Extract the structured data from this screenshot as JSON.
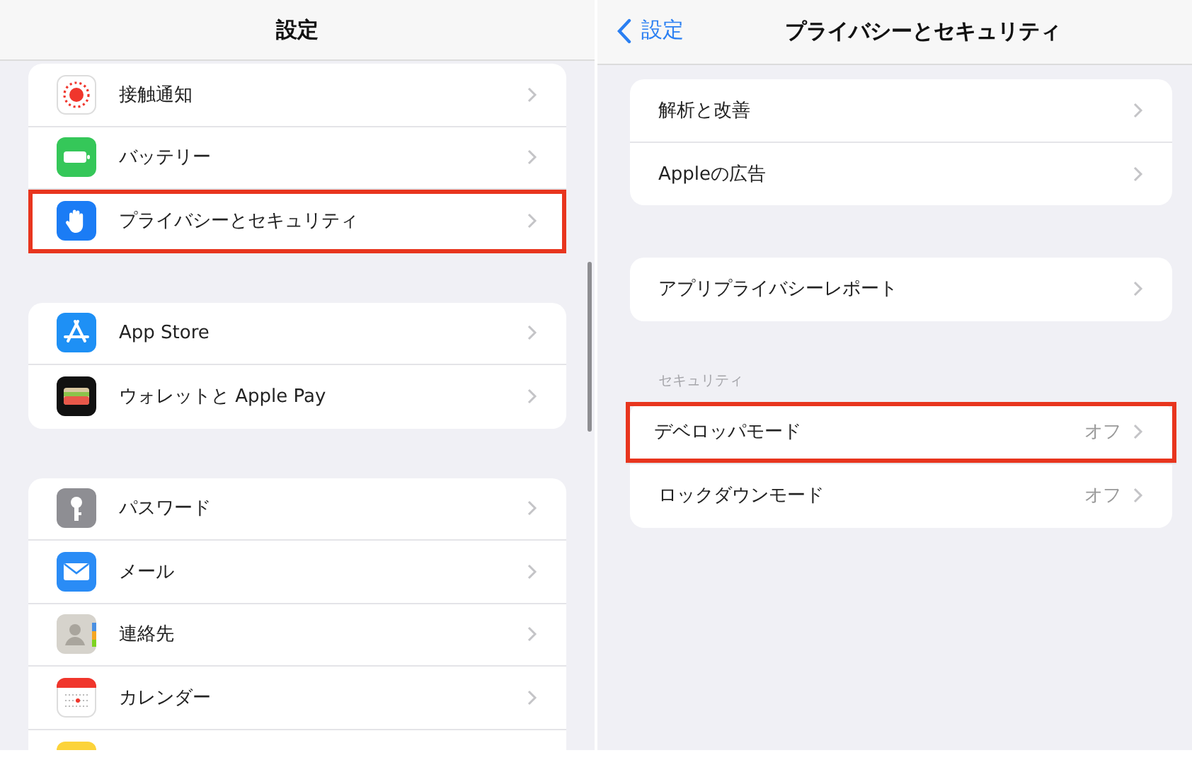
{
  "settings_panel": {
    "title": "設定",
    "groups": [
      {
        "items": [
          {
            "kind": "exposure",
            "label": "接触通知",
            "highlighted": false
          },
          {
            "kind": "battery",
            "label": "バッテリー",
            "highlighted": false
          },
          {
            "kind": "privacy",
            "label": "プライバシーとセキュリティ",
            "highlighted": true
          }
        ]
      },
      {
        "items": [
          {
            "kind": "appstore",
            "label": "App Store",
            "highlighted": false
          },
          {
            "kind": "wallet",
            "label": "ウォレットと Apple Pay",
            "highlighted": false
          }
        ]
      },
      {
        "items": [
          {
            "kind": "passwords",
            "label": "パスワード",
            "highlighted": false
          },
          {
            "kind": "mail",
            "label": "メール",
            "highlighted": false
          },
          {
            "kind": "contacts",
            "label": "連絡先",
            "highlighted": false
          },
          {
            "kind": "calendar",
            "label": "カレンダー",
            "highlighted": false
          },
          {
            "kind": "notes",
            "highlighted": false
          }
        ]
      }
    ]
  },
  "privacy_panel": {
    "back": "設定",
    "title": "プライバシーとセキュリティ",
    "groups": [
      {
        "items": [
          {
            "label": "解析と改善",
            "highlighted": false
          },
          {
            "label": "Appleの広告",
            "highlighted": false
          }
        ]
      },
      {
        "items": [
          {
            "label": "アプリプライバシーレポート",
            "highlighted": false
          }
        ]
      },
      {
        "header": "セキュリティ",
        "items": [
          {
            "label": "デベロッパモード",
            "value": "オフ",
            "highlighted": true
          },
          {
            "label": "ロックダウンモード",
            "value": "オフ",
            "highlighted": false
          }
        ]
      }
    ]
  }
}
